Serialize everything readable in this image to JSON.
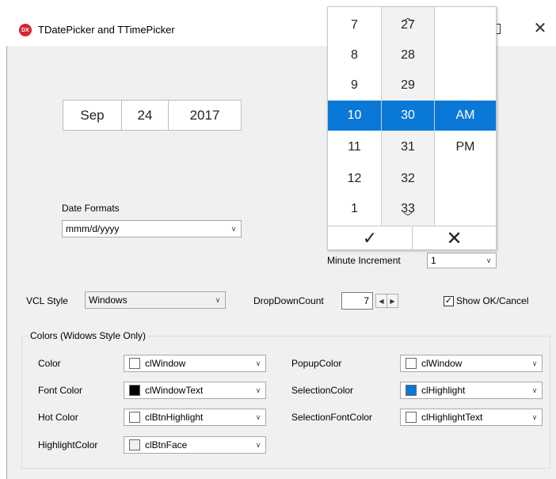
{
  "window": {
    "title": "TDatePicker and TTimePicker",
    "icon_text": "DX",
    "maximize_icon": "maximize-icon",
    "close_glyph": "✕"
  },
  "date_picker": {
    "month": "Sep",
    "day": "24",
    "year": "2017"
  },
  "date_formats": {
    "label": "Date Formats",
    "value": "mmm/d/yyyy"
  },
  "minute_increment": {
    "label": "Minute Increment",
    "value": "1"
  },
  "vcl_style": {
    "label": "VCL Style",
    "value": "Windows"
  },
  "dropdown_count": {
    "label": "DropDownCount",
    "value": "7"
  },
  "show_ok_cancel": {
    "label": "Show OK/Cancel",
    "checked": true
  },
  "colors_group": {
    "title": "Colors (Widows Style Only)",
    "left": [
      {
        "label": "Color",
        "value": "clWindow",
        "swatch": "#ffffff"
      },
      {
        "label": "Font Color",
        "value": "clWindowText",
        "swatch": "#000000"
      },
      {
        "label": "Hot Color",
        "value": "clBtnHighlight",
        "swatch": "#ffffff"
      },
      {
        "label": "HighlightColor",
        "value": "clBtnFace",
        "swatch": "#f0f0f0"
      }
    ],
    "right": [
      {
        "label": "PopupColor",
        "value": "clWindow",
        "swatch": "#ffffff"
      },
      {
        "label": "SelectionColor",
        "value": "clHighlight",
        "swatch": "#0a78d7"
      },
      {
        "label": "SelectionFontColor",
        "value": "clHighlightText",
        "swatch": "#ffffff"
      }
    ]
  },
  "time_picker": {
    "hours": [
      "7",
      "8",
      "9",
      "10",
      "11",
      "12",
      "1"
    ],
    "minutes": [
      "27",
      "28",
      "29",
      "30",
      "31",
      "32",
      "33"
    ],
    "ampm": [
      "AM",
      "PM"
    ],
    "selected_hour": "10",
    "selected_minute": "30",
    "selected_ampm": "AM",
    "accept_glyph": "✓",
    "cancel_glyph": "✕",
    "accent": "#0a78d7"
  }
}
